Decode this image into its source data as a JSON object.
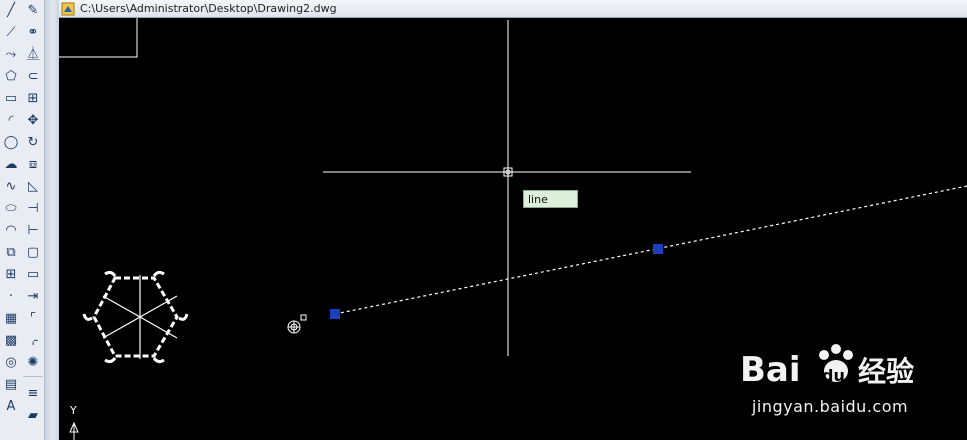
{
  "window": {
    "title_path": "C:\\Users\\Administrator\\Desktop\\Drawing2.dwg"
  },
  "drawing": {
    "command_tooltip": "line",
    "ucs_axis_label": "Y",
    "background_color": "#000000",
    "entity_color": "#ffffff",
    "grip_color": "#1d3fbf"
  },
  "toolbars": {
    "draw": [
      "line-icon",
      "construction-line-icon",
      "polyline-icon",
      "polygon-icon",
      "rectangle-icon",
      "arc-icon",
      "circle-icon",
      "revision-cloud-icon",
      "spline-icon",
      "ellipse-icon",
      "ellipse-arc-icon",
      "insert-block-icon",
      "make-block-icon",
      "point-icon",
      "hatch-icon",
      "gradient-icon",
      "region-icon",
      "table-icon",
      "multiline-text-icon"
    ],
    "modify": [
      "erase-icon",
      "copy-icon",
      "mirror-icon",
      "offset-icon",
      "array-icon",
      "move-icon",
      "rotate-icon",
      "scale-icon",
      "stretch-icon",
      "trim-icon",
      "extend-icon",
      "break-at-point-icon",
      "break-icon",
      "join-icon",
      "chamfer-icon",
      "fillet-icon",
      "explode-icon"
    ]
  },
  "watermark": {
    "brand_a": "Bai",
    "brand_b": "du",
    "brand_cn": "经验",
    "url": "jingyan.baidu.com"
  }
}
